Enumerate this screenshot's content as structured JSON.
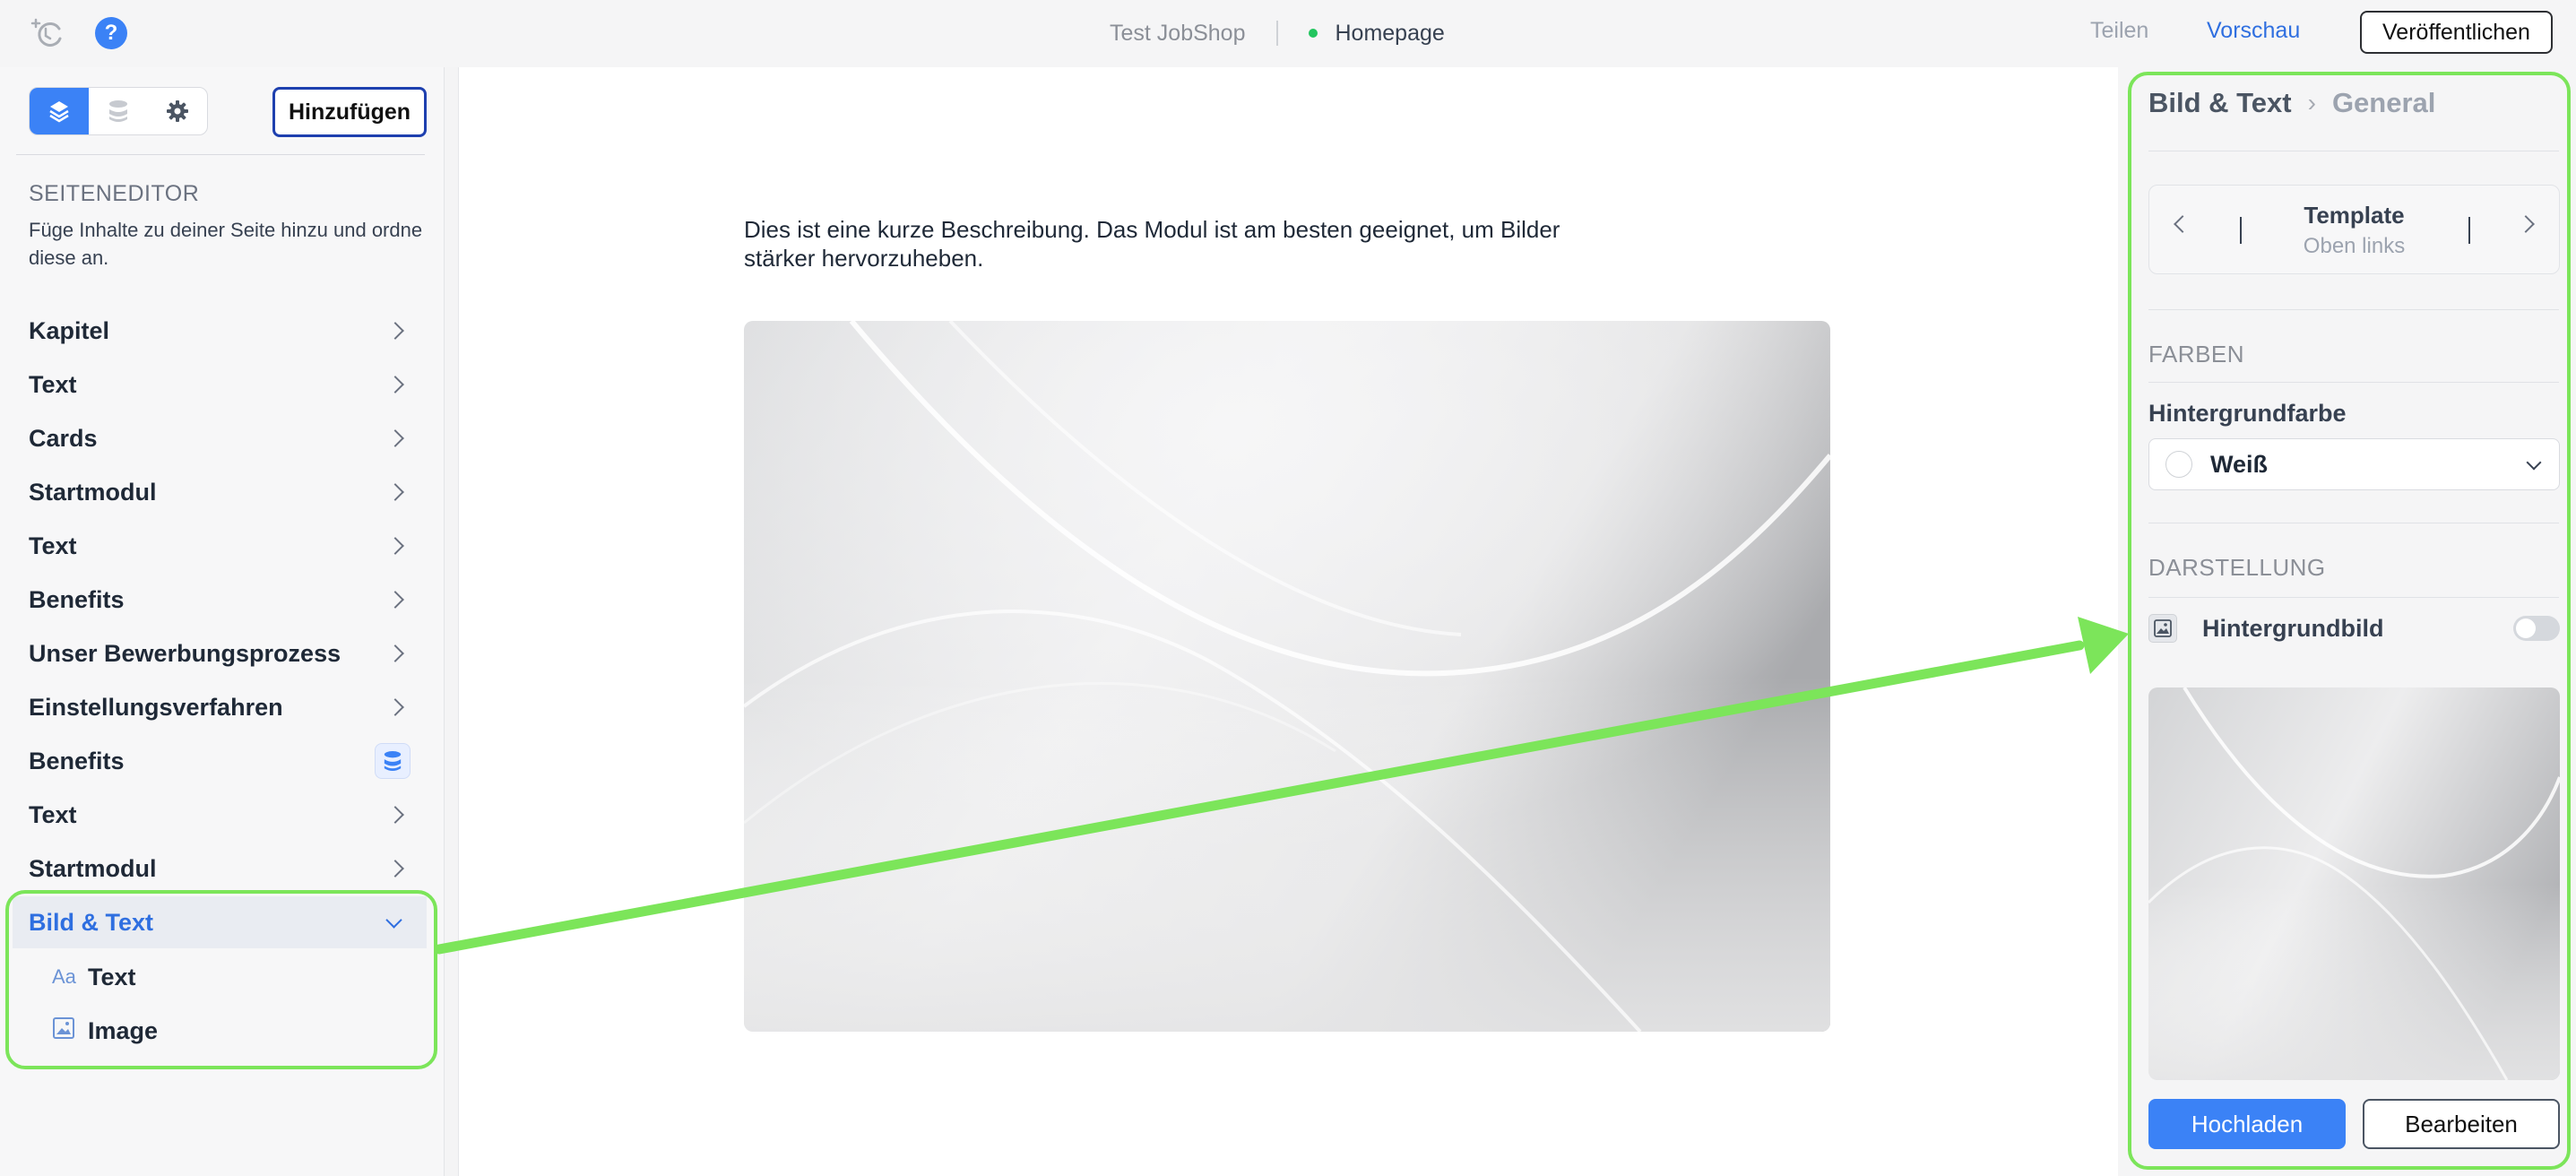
{
  "topbar": {
    "shop_name": "Test JobShop",
    "page_name": "Homepage",
    "share_label": "Teilen",
    "preview_label": "Vorschau",
    "publish_label": "Veröffentlichen",
    "help_label": "?"
  },
  "left_panel": {
    "add_label": "Hinzufügen",
    "section_title": "SEITENEDITOR",
    "section_description": "Füge Inhalte zu deiner Seite hinzu und ordne diese an.",
    "items": [
      {
        "label": "Kapitel"
      },
      {
        "label": "Text"
      },
      {
        "label": "Cards"
      },
      {
        "label": "Startmodul"
      },
      {
        "label": "Text"
      },
      {
        "label": "Benefits"
      },
      {
        "label": "Unser Bewerbungsprozess"
      },
      {
        "label": "Einstellungsverfahren"
      },
      {
        "label": "Benefits"
      },
      {
        "label": "Text"
      },
      {
        "label": "Startmodul"
      },
      {
        "label": "Bild & Text"
      }
    ],
    "subitems": [
      {
        "icon": "Aa",
        "label": "Text"
      },
      {
        "icon": "image-icon",
        "label": "Image"
      }
    ]
  },
  "canvas": {
    "description": "Dies ist eine kurze Beschreibung. Das Modul ist am besten geeignet, um Bilder stärker hervorzuheben."
  },
  "right_panel": {
    "breadcrumb": {
      "module": "Bild & Text",
      "tab": "General"
    },
    "template": {
      "title": "Template",
      "value": "Oben links"
    },
    "colors_section": "FARBEN",
    "background_color_label": "Hintergrundfarbe",
    "background_color_value": "Weiß",
    "display_section": "DARSTELLUNG",
    "background_image_label": "Hintergrundbild",
    "background_image_enabled": false,
    "upload_label": "Hochladen",
    "edit_label": "Bearbeiten"
  },
  "colors": {
    "accent": "#3b82f6",
    "highlight": "#7ce55a",
    "status_dot": "#22c55e"
  }
}
